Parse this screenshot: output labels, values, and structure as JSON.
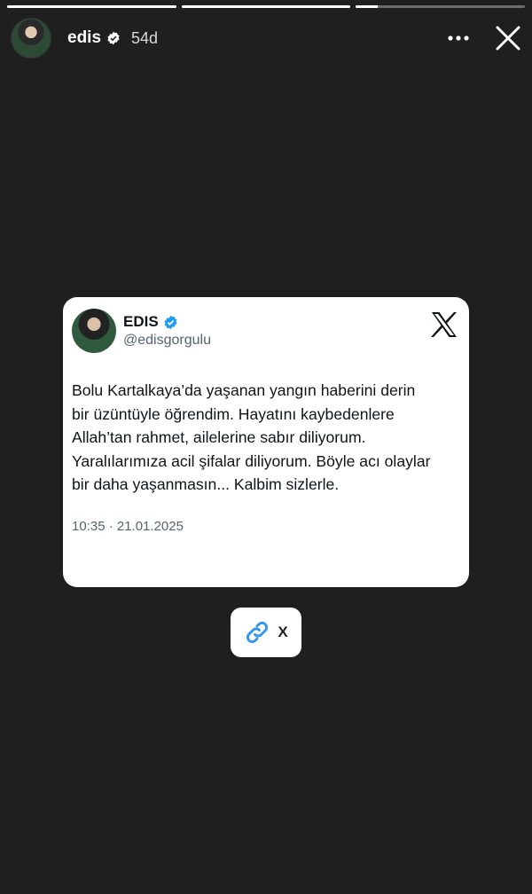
{
  "story": {
    "username": "edis",
    "time_ago": "54d",
    "progress": [
      1.0,
      1.0,
      0.13
    ]
  },
  "tweet": {
    "display_name": "EDIS",
    "handle": "@edisgorgulu",
    "text_lines": [
      "Bolu Kartalkaya’da yaşanan yangın haberini derin",
      "bir üzüntüyle öğrendim. Hayatını kaybedenlere",
      "Allah’tan rahmet, ailelerine sabır diliyorum.",
      "Yaralılarımıza acil şifalar diliyorum. Böyle acı olaylar",
      "bir daha yaşanmasın... Kalbim sizlerle."
    ],
    "timestamp": "10:35 · 21.01.2025"
  },
  "link_sticker": {
    "label": "X"
  },
  "colors": {
    "background": "#1f1f1f",
    "verified_blue": "#1d9bf0",
    "link_blue": "#3797f0"
  },
  "icons": [
    "verified-badge-icon",
    "more-options-icon",
    "close-icon",
    "x-logo-icon",
    "link-icon"
  ]
}
